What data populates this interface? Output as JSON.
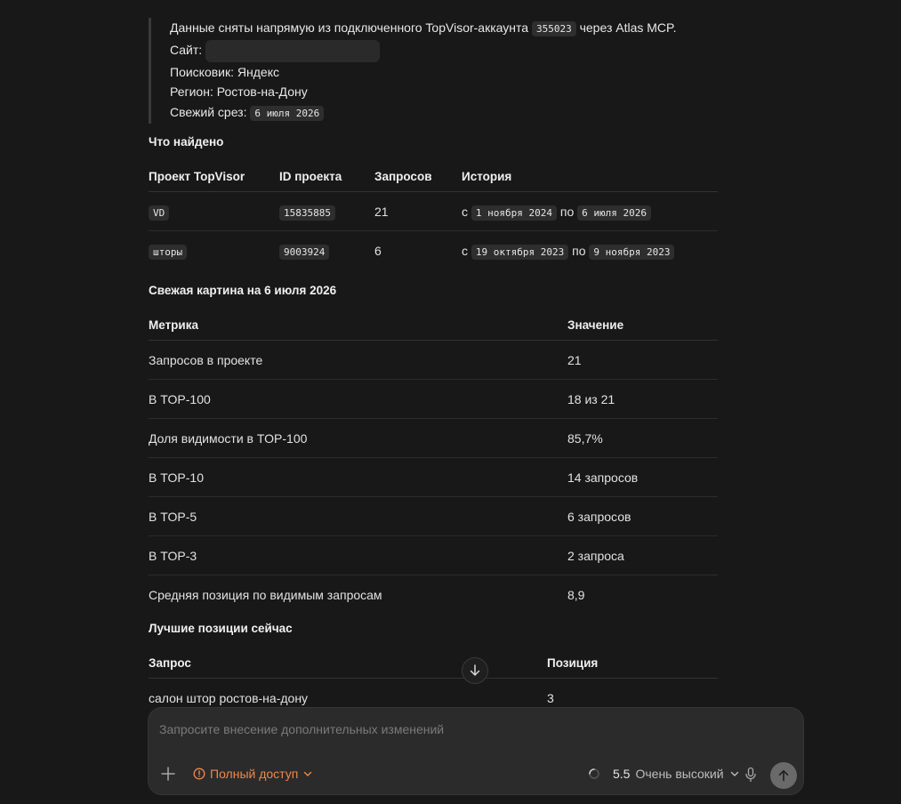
{
  "quote": {
    "line1_prefix": "Данные сняты напрямую из подключенного TopVisor-аккаунта",
    "account_id": "355023",
    "line1_suffix": "через Atlas MCP.",
    "site_label": "Сайт:",
    "engine": "Поисковик: Яндекс",
    "region": "Регион: Ростов-на-Дону",
    "snapshot_label": "Свежий срез:",
    "snapshot_date": "6 июля 2026"
  },
  "found": {
    "title": "Что найдено",
    "headers": [
      "Проект TopVisor",
      "ID проекта",
      "Запросов",
      "История"
    ],
    "rows": [
      {
        "project": "VD",
        "id": "15835885",
        "queries": "21",
        "from_prefix": "с",
        "from": "1 ноября 2024",
        "to_prefix": "по",
        "to": "6 июля 2026"
      },
      {
        "project": "шторы",
        "id": "9003924",
        "queries": "6",
        "from_prefix": "с",
        "from": "19 октября 2023",
        "to_prefix": "по",
        "to": "9 ноября 2023"
      }
    ]
  },
  "fresh": {
    "title": "Свежая картина на 6 июля 2026",
    "headers": [
      "Метрика",
      "Значение"
    ],
    "rows": [
      {
        "metric": "Запросов в проекте",
        "value": "21"
      },
      {
        "metric": "В TOP-100",
        "value": "18 из 21"
      },
      {
        "metric": "Доля видимости в TOP-100",
        "value": "85,7%"
      },
      {
        "metric": "В TOP-10",
        "value": "14 запросов"
      },
      {
        "metric": "В TOP-5",
        "value": "6 запросов"
      },
      {
        "metric": "В TOP-3",
        "value": "2 запроса"
      },
      {
        "metric": "Средняя позиция по видимым запросам",
        "value": "8,9"
      }
    ]
  },
  "best": {
    "title": "Лучшие позиции сейчас",
    "headers": [
      "Запрос",
      "Позиция"
    ],
    "rows": [
      {
        "query": "салон штор ростов-на-дону",
        "position": "3"
      }
    ]
  },
  "composer": {
    "placeholder": "Запросите внесение дополнительных изменений",
    "access_label": "Полный доступ",
    "model_version": "5.5",
    "model_effort": "Очень высокий"
  },
  "colors": {
    "background": "#181818",
    "accent_orange": "#f0884a",
    "code_bg": "#2e2e2e"
  },
  "icons": [
    "scroll-down-icon",
    "plus-icon",
    "warning-icon",
    "chevron-down-icon",
    "spinner-icon",
    "microphone-icon",
    "send-arrow-icon"
  ]
}
